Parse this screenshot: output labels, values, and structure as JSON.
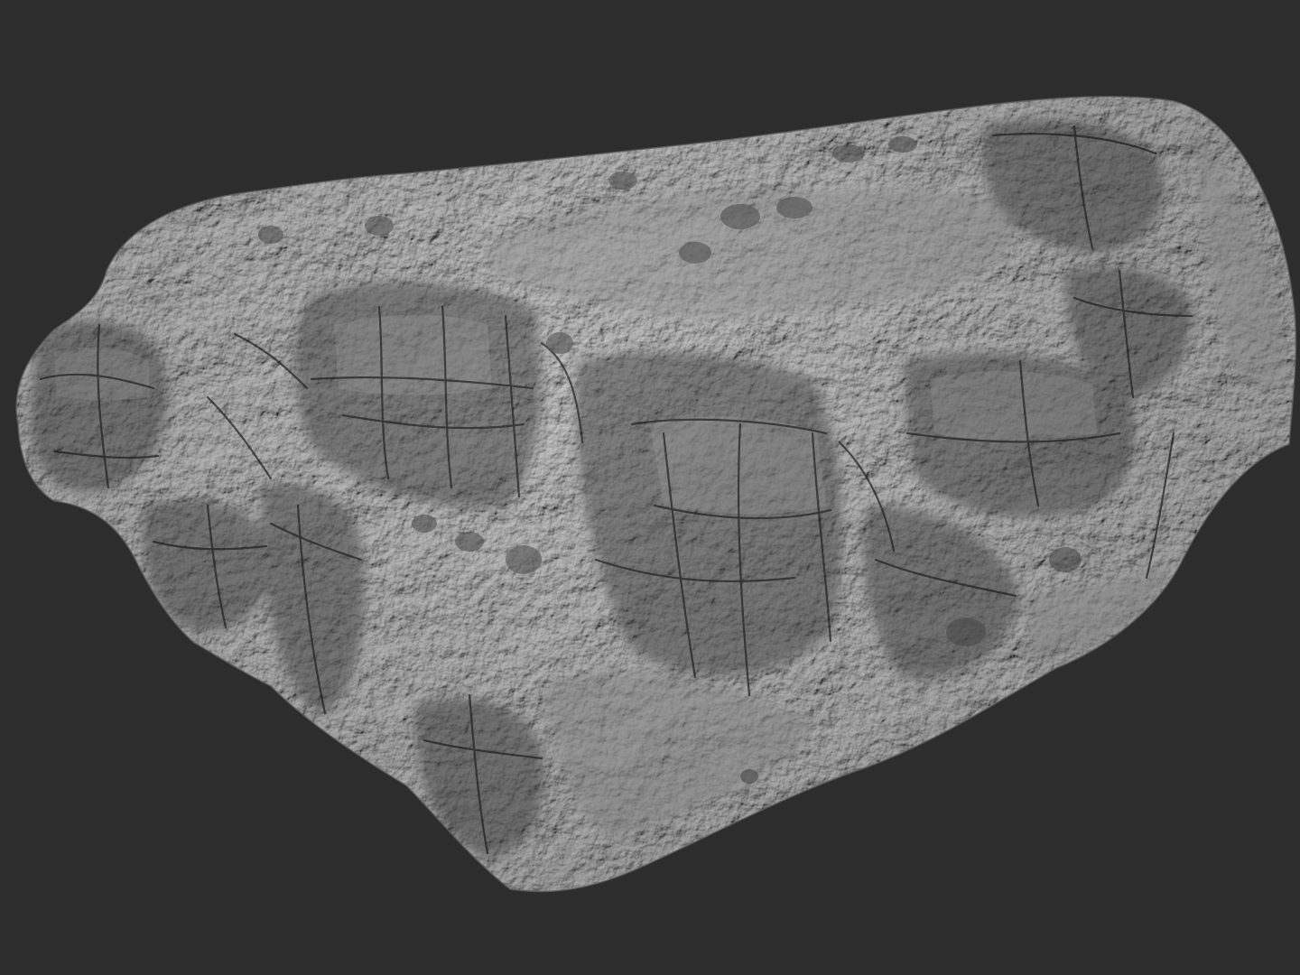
{
  "scene": {
    "subject": "rock-terrain-sculpt",
    "colors": {
      "background": "#2d2d2d",
      "surface_light": "#9a9a9a",
      "surface_mid": "#6e6e6e",
      "surface_dark": "#3a3a3a",
      "crevice": "#262626"
    }
  }
}
